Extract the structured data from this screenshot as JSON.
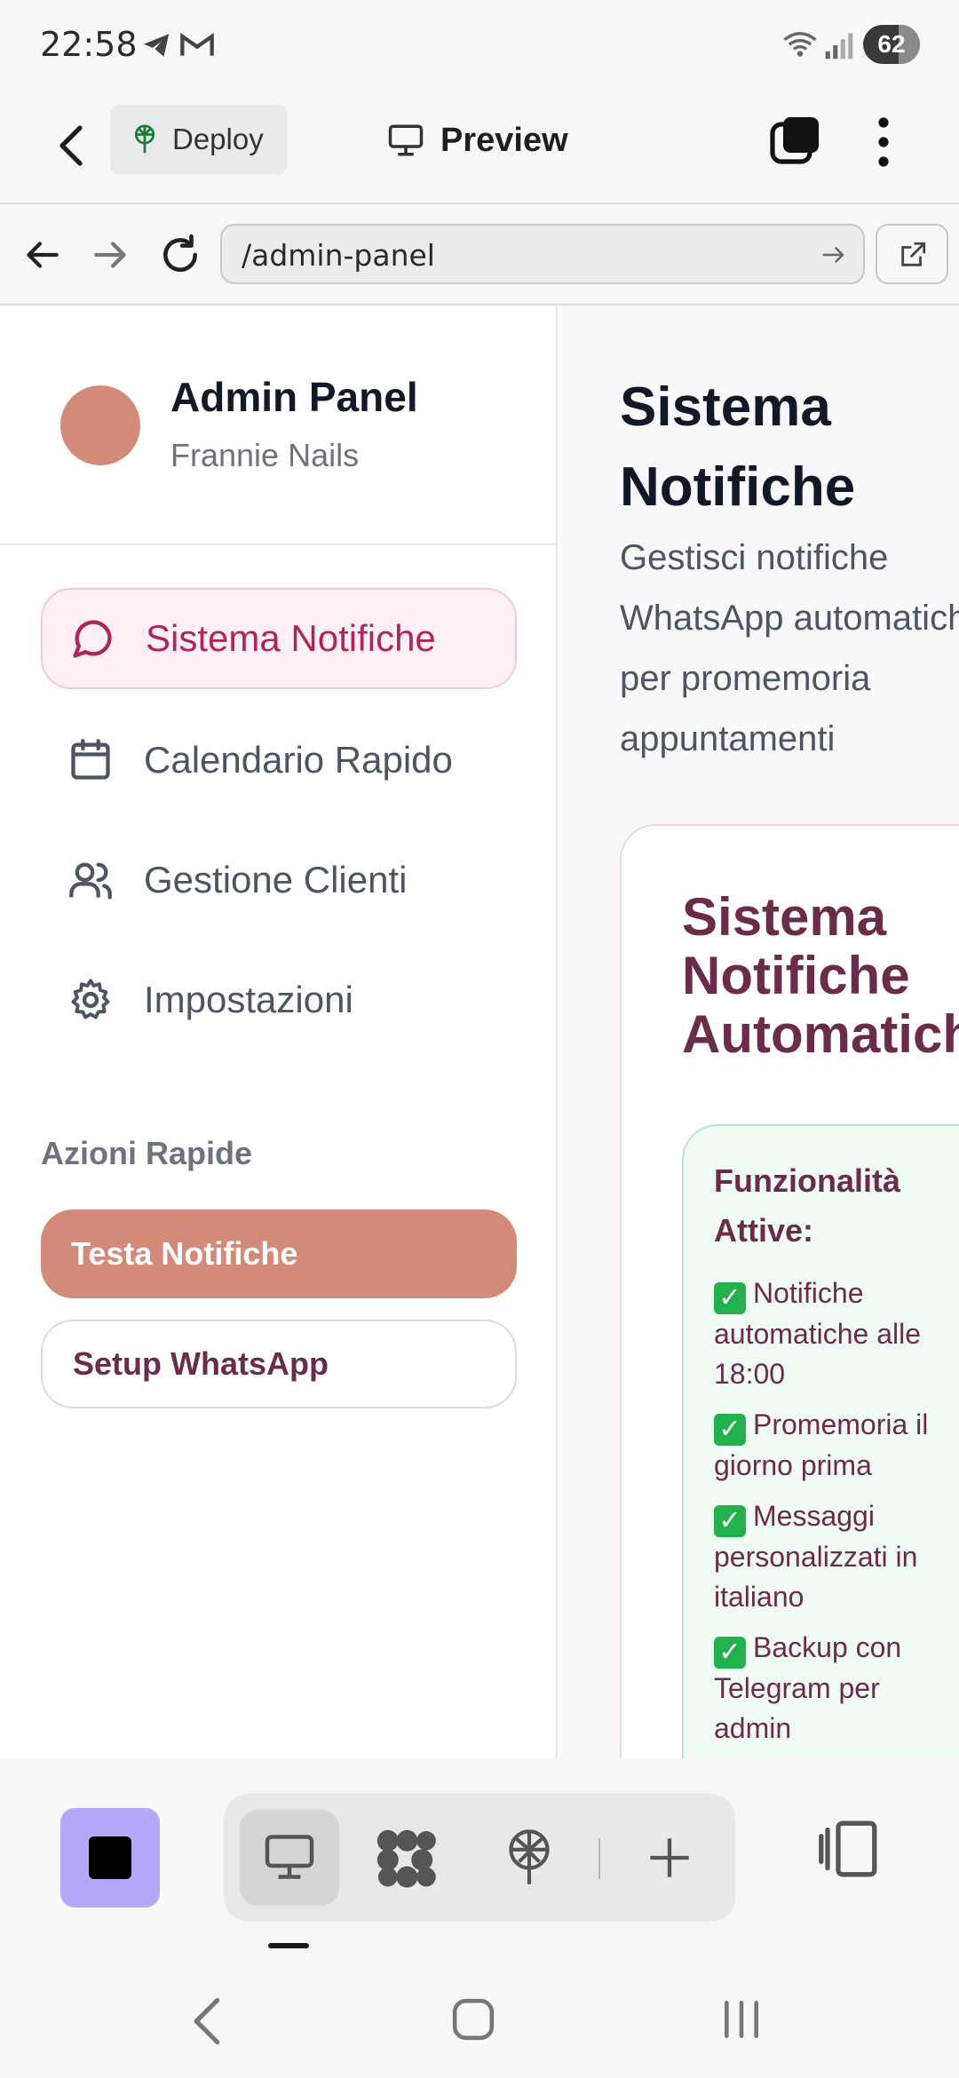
{
  "status_bar": {
    "time": "22:58",
    "battery": "62"
  },
  "app_bar": {
    "deploy_label": "Deploy",
    "preview_label": "Preview"
  },
  "browser": {
    "url": "/admin-panel"
  },
  "sidebar": {
    "title": "Admin Panel",
    "subtitle": "Frannie Nails",
    "nav": [
      {
        "label": "Sistema Notifiche",
        "icon": "message-circle-icon"
      },
      {
        "label": "Calendario Rapido",
        "icon": "calendar-icon"
      },
      {
        "label": "Gestione Clienti",
        "icon": "users-icon"
      },
      {
        "label": "Impostazioni",
        "icon": "gear-icon"
      }
    ],
    "quick_actions_label": "Azioni Rapide",
    "primary_action": "Testa Notifiche",
    "secondary_action": "Setup WhatsApp"
  },
  "main": {
    "title": "Sistema Notifiche",
    "description_lines": [
      "Gestisci notifiche",
      "WhatsApp automatiche",
      "per promemoria",
      "appuntamenti"
    ],
    "card_title_lines": [
      "Sistema",
      "Notifiche",
      "Automatiche"
    ],
    "features_title": "Funzionalità Attive:",
    "features": [
      "Notifiche automatiche alle 18:00",
      "Promemoria il giorno prima",
      "Messaggi personalizzati in italiano",
      "Backup con Telegram per admin"
    ]
  },
  "colors": {
    "accent": "#d48a78",
    "active_nav": "#b0245c",
    "brand_text": "#6b2b4b",
    "toolbar_stop": "#b5a8fb"
  }
}
